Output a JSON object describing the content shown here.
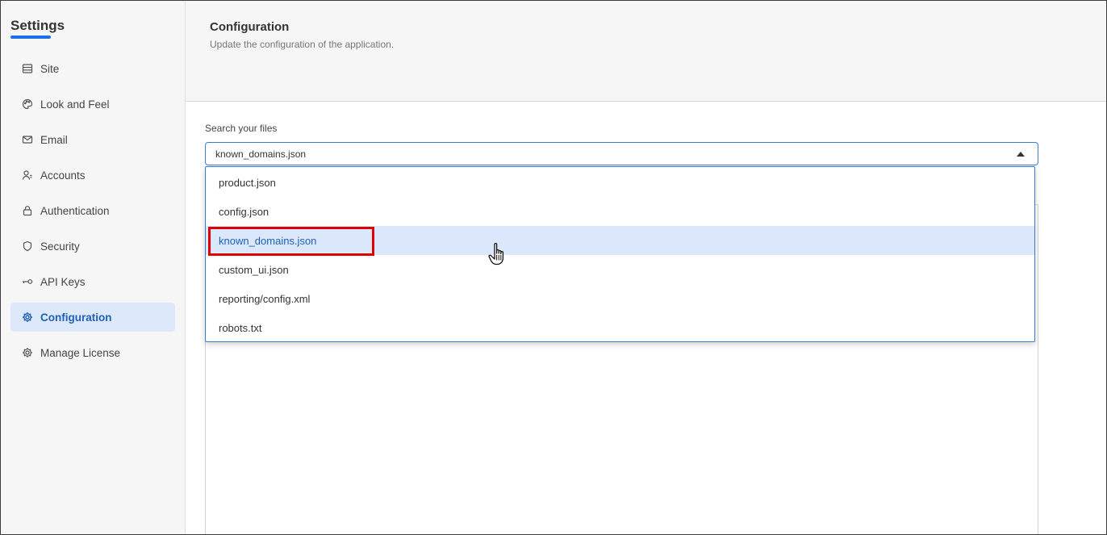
{
  "sidebar": {
    "title": "Settings",
    "accent_color": "#1f6feb",
    "items": [
      {
        "label": "Site",
        "icon": "site-icon",
        "active": false
      },
      {
        "label": "Look and Feel",
        "icon": "palette-icon",
        "active": false
      },
      {
        "label": "Email",
        "icon": "mail-icon",
        "active": false
      },
      {
        "label": "Accounts",
        "icon": "accounts-icon",
        "active": false
      },
      {
        "label": "Authentication",
        "icon": "lock-icon",
        "active": false
      },
      {
        "label": "Security",
        "icon": "shield-icon",
        "active": false
      },
      {
        "label": "API Keys",
        "icon": "key-icon",
        "active": false
      },
      {
        "label": "Configuration",
        "icon": "gear-icon",
        "active": true
      },
      {
        "label": "Manage License",
        "icon": "license-icon",
        "active": false
      }
    ]
  },
  "header": {
    "title": "Configuration",
    "subtitle": "Update the configuration of the application."
  },
  "file_select": {
    "label": "Search your files",
    "value": "known_domains.json",
    "options": [
      {
        "label": "product.json",
        "highlighted": false
      },
      {
        "label": "config.json",
        "highlighted": false
      },
      {
        "label": "known_domains.json",
        "highlighted": true
      },
      {
        "label": "custom_ui.json",
        "highlighted": false
      },
      {
        "label": "reporting/config.xml",
        "highlighted": false
      },
      {
        "label": "robots.txt",
        "highlighted": false
      }
    ]
  },
  "colors": {
    "highlight_outline": "#e00000",
    "option_hover_bg": "#dbe8fb",
    "active_nav_bg": "#dde8fa"
  }
}
